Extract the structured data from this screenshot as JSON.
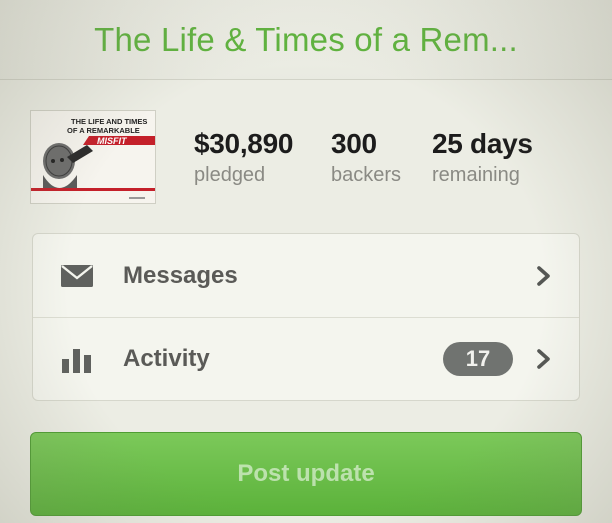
{
  "header": {
    "title": "The Life & Times of a Rem..."
  },
  "project": {
    "thumbnail": {
      "alt": "project-artwork",
      "line1": "THE LIFE AND TIMES",
      "line2": "OF A REMARKABLE",
      "line3": "MISFIT"
    },
    "stats": [
      {
        "value": "$30,890",
        "label": "pledged"
      },
      {
        "value": "300",
        "label": "backers"
      },
      {
        "value": "25 days",
        "label": "remaining"
      }
    ]
  },
  "menu": {
    "items": [
      {
        "label": "Messages",
        "icon": "envelope-icon"
      },
      {
        "label": "Activity",
        "icon": "bar-chart-icon",
        "badge": "17"
      }
    ]
  },
  "actions": {
    "post_update_label": "Post update"
  },
  "colors": {
    "accent_green": "#5fb43e",
    "button_green": "#6cbd4a",
    "badge_gray": "#707370"
  }
}
